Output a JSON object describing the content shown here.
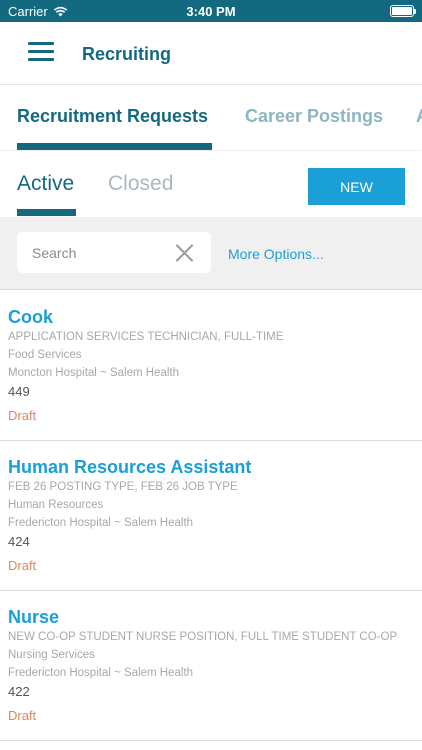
{
  "status_bar": {
    "carrier": "Carrier",
    "time": "3:40 PM"
  },
  "header": {
    "title": "Recruiting"
  },
  "top_tabs": [
    {
      "label": "Recruitment Requests",
      "active": true
    },
    {
      "label": "Career Postings",
      "active": false
    },
    {
      "label": "A",
      "active": false
    }
  ],
  "sub_tabs": [
    {
      "label": "Active",
      "active": true
    },
    {
      "label": "Closed",
      "active": false
    }
  ],
  "new_button_label": "NEW",
  "search": {
    "placeholder": "Search",
    "value": "",
    "more_options": "More Options..."
  },
  "requests": [
    {
      "title": "Cook",
      "subtitle": "APPLICATION SERVICES TECHNICIAN, FULL-TIME",
      "department": "Food Services",
      "location": "Moncton Hospital ~ Salem Health",
      "number": "449",
      "status": "Draft"
    },
    {
      "title": "Human Resources Assistant",
      "subtitle": "FEB 26 POSTING TYPE, FEB 26 JOB TYPE",
      "department": "Human Resources",
      "location": "Fredericton Hospital ~ Salem Health",
      "number": "424",
      "status": "Draft"
    },
    {
      "title": "Nurse",
      "subtitle": "NEW CO-OP STUDENT NURSE POSITION, FULL TIME STUDENT CO-OP",
      "department": "Nursing Services",
      "location": "Fredericton Hospital ~ Salem Health",
      "number": "422",
      "status": "Draft"
    }
  ],
  "colors": {
    "primary": "#136a80",
    "accent": "#1a9fd6",
    "inactive_tab": "#8cb6c4",
    "draft_status": "#d98a5f"
  }
}
